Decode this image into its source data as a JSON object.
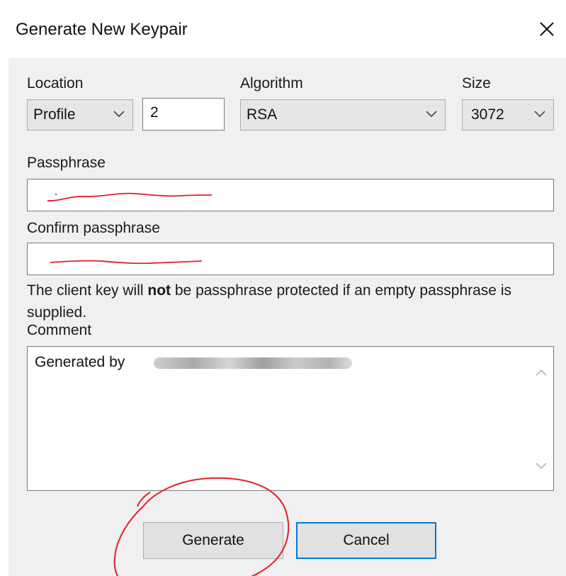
{
  "dialog": {
    "title": "Generate New Keypair",
    "close_icon": "close-icon"
  },
  "location": {
    "label": "Location",
    "selected": "Profile",
    "index_value": "2"
  },
  "algorithm": {
    "label": "Algorithm",
    "selected": "RSA"
  },
  "size": {
    "label": "Size",
    "selected": "3072"
  },
  "passphrase": {
    "label": "Passphrase",
    "value": ""
  },
  "confirm_passphrase": {
    "label": "Confirm passphrase",
    "value": ""
  },
  "note": {
    "before": "The client key will ",
    "bold": "not",
    "after": " be passphrase protected if an empty passphrase is supplied."
  },
  "comment": {
    "label": "Comment",
    "value": "Generated by"
  },
  "buttons": {
    "generate": "Generate",
    "cancel": "Cancel"
  },
  "colors": {
    "annotation_red": "#e0202a",
    "focus_blue": "#0078d7",
    "dialog_bg": "#f0f0f0"
  }
}
